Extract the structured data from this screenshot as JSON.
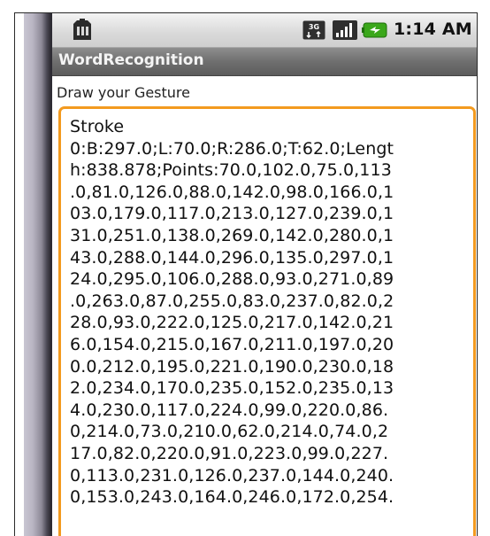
{
  "status_bar": {
    "time": "1:14 AM",
    "network_label": "3G",
    "icons": [
      "sim-card-icon",
      "3g-icon",
      "signal-icon",
      "battery-icon"
    ]
  },
  "app": {
    "title": "WordRecognition"
  },
  "gesture": {
    "prompt": "Draw your Gesture",
    "stroke_text": "Stroke\n0:B:297.0;L:70.0;R:286.0;T:62.0;Lengt\nh:838.878;Points:70.0,102.0,75.0,113\n.0,81.0,126.0,88.0,142.0,98.0,166.0,1\n03.0,179.0,117.0,213.0,127.0,239.0,1\n31.0,251.0,138.0,269.0,142.0,280.0,1\n43.0,288.0,144.0,296.0,135.0,297.0,1\n24.0,295.0,106.0,288.0,93.0,271.0,89\n.0,263.0,87.0,255.0,83.0,237.0,82.0,2\n28.0,93.0,222.0,125.0,217.0,142.0,21\n6.0,154.0,215.0,167.0,211.0,197.0,20\n0.0,212.0,195.0,221.0,190.0,230.0,18\n2.0,234.0,170.0,235.0,152.0,235.0,13\n4.0,230.0,117.0,224.0,99.0,220.0,86.\n0,214.0,73.0,210.0,62.0,214.0,74.0,2\n17.0,82.0,220.0,91.0,223.0,99.0,227.\n0,113.0,231.0,126.0,237.0,144.0,240.\n0,153.0,243.0,164.0,246.0,172.0,254."
  },
  "colors": {
    "accent_border": "#f39a1f",
    "battery_green": "#3aa71a",
    "title_bar": "#6f6f6f"
  }
}
